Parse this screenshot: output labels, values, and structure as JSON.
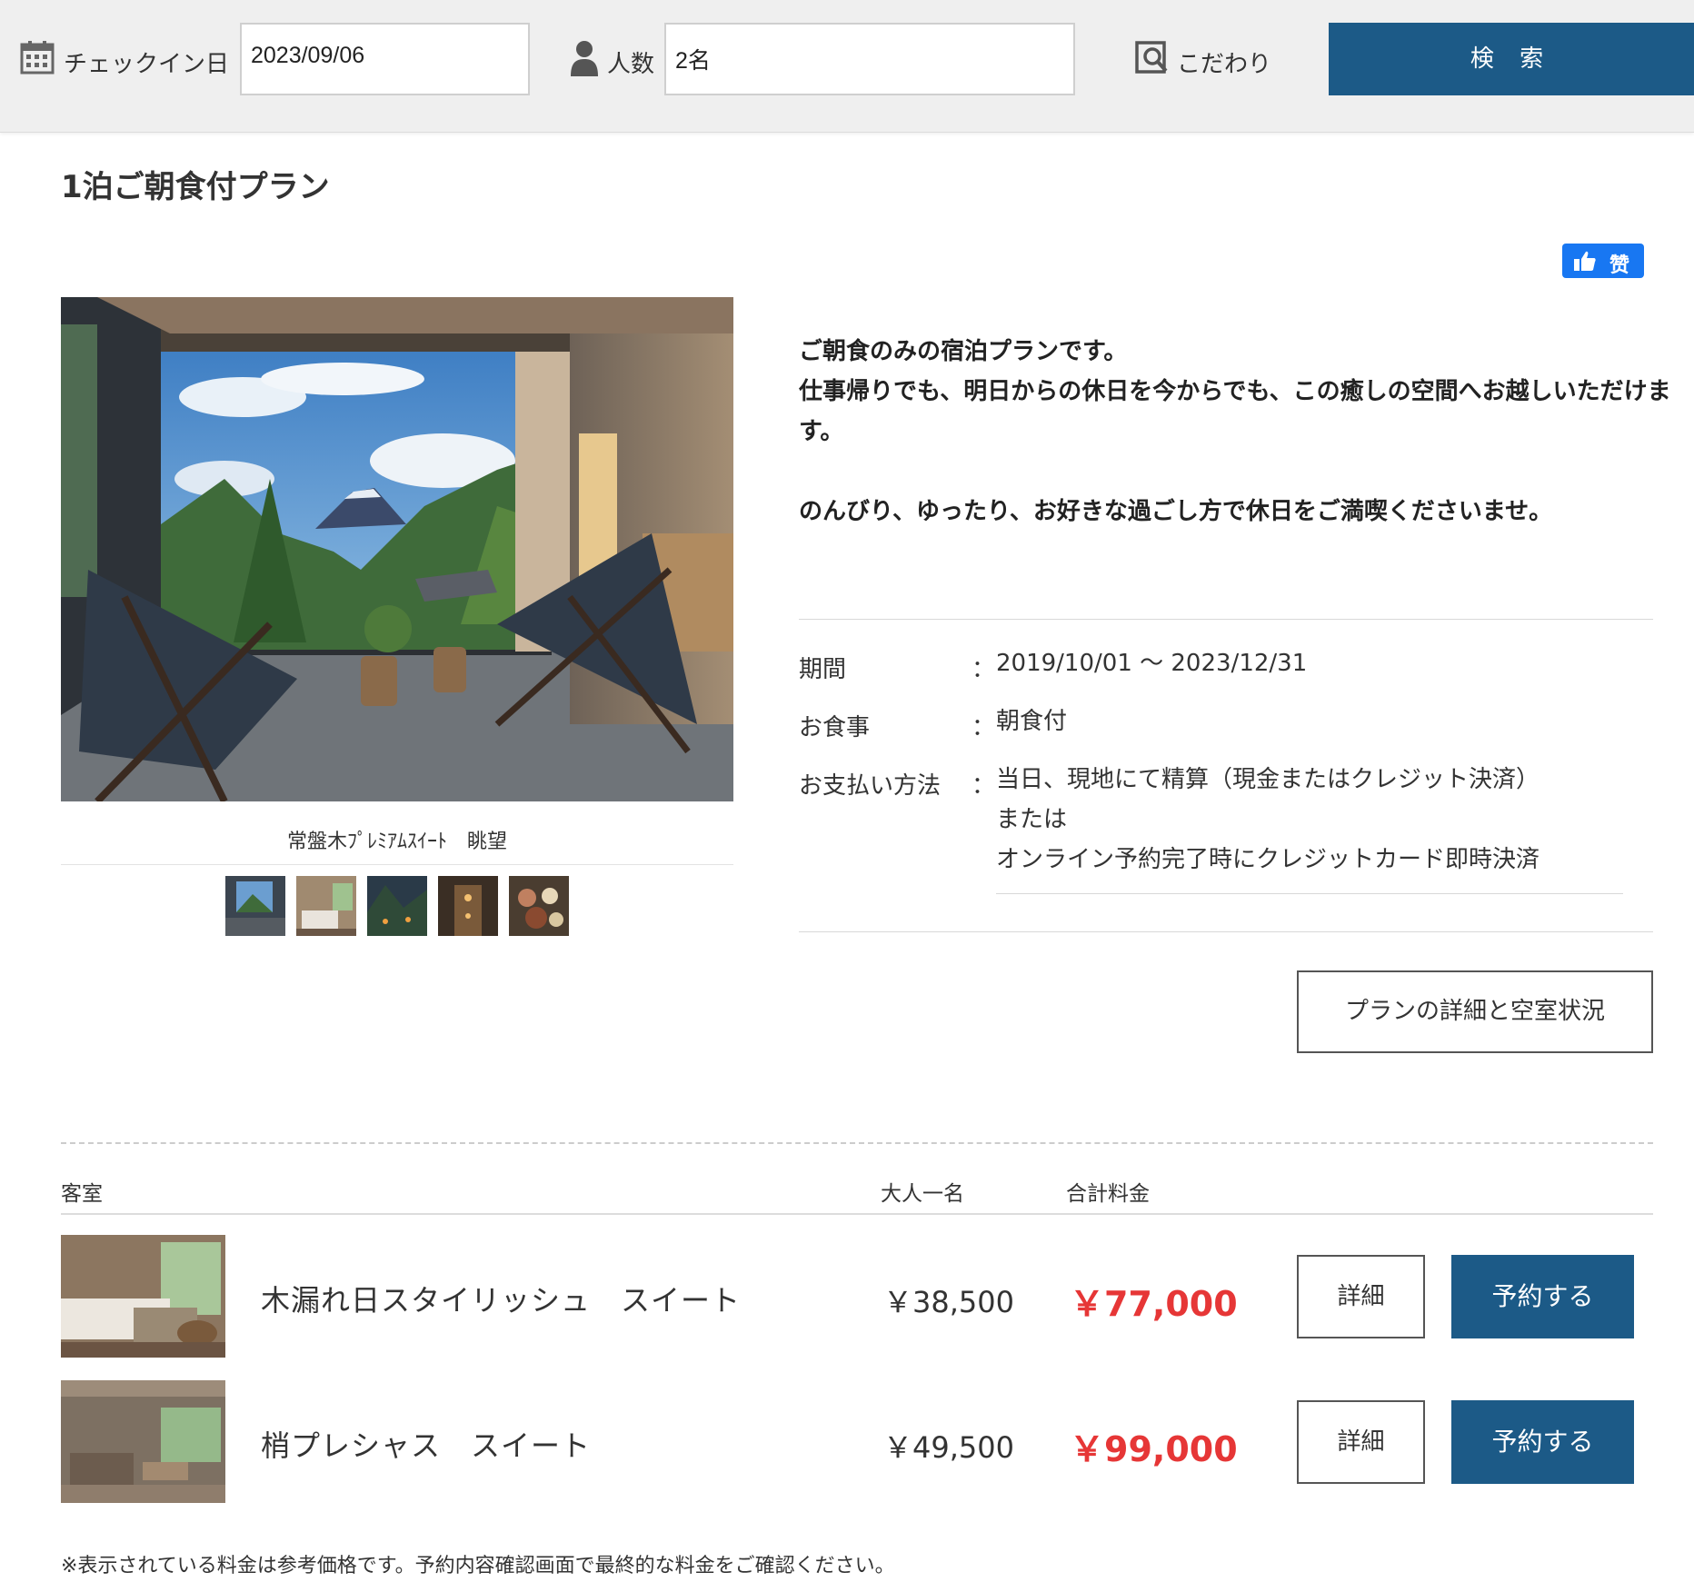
{
  "search": {
    "checkin_label": "チェックイン日",
    "checkin_value": "2023/09/06",
    "guests_label": "人数",
    "guests_value": "2名",
    "preference_label": "こだわり",
    "search_button": "検 索"
  },
  "plan": {
    "title": "1泊ご朝食付プラン",
    "like_button": "赞",
    "photo_caption": "常盤木ﾌﾟﾚﾐｱﾑｽｲｰﾄ　眺望",
    "description": [
      "ご朝食のみの宿泊プランです。\n仕事帰りでも、明日からの休日を今からでも、この癒しの空間へお越しいただけます。",
      "のんびり、ゆったり、お好きな過ごし方で休日をご満喫くださいませ。"
    ],
    "info": {
      "period_label": "期間",
      "period_value": "2019/10/01 〜 2023/12/31",
      "meal_label": "お食事",
      "meal_value": "朝食付",
      "payment_label": "お支払い方法",
      "payment_lines": [
        "当日、現地にて精算（現金またはクレジット決済）",
        "または",
        "オンライン予約完了時にクレジットカード即時決済"
      ]
    },
    "detail_button": "プランの詳細と空室状況"
  },
  "rooms": {
    "headers": {
      "room": "客室",
      "per_adult": "大人一名",
      "total": "合計料金"
    },
    "items": [
      {
        "name": "木漏れ日スタイリッシュ　スイート",
        "per_adult": "￥38,500",
        "total": "￥77,000",
        "detail": "詳細",
        "reserve": "予約する"
      },
      {
        "name": "梢プレシャス　スイート",
        "per_adult": "￥49,500",
        "total": "￥99,000",
        "detail": "詳細",
        "reserve": "予約する"
      }
    ]
  },
  "footnote": "※表示されている料金は参考価格です。予約内容確認画面で最終的な料金をご確認ください。",
  "colors": {
    "primary": "#1c5a87",
    "price_red": "#e63636",
    "like_blue": "#1877f2",
    "bar_bg": "#efefef"
  },
  "icons": [
    "calendar-icon",
    "person-icon",
    "preference-search-icon",
    "thumbs-up-icon"
  ]
}
